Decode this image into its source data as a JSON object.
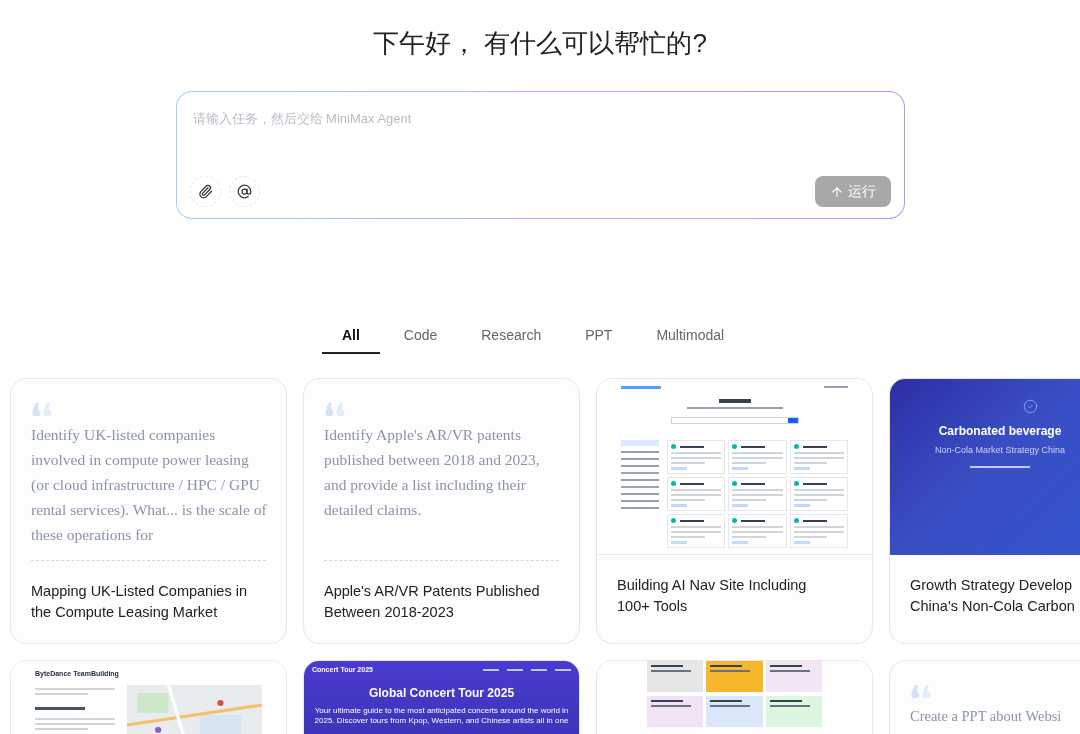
{
  "greeting": "下午好， 有什么可以帮忙的?",
  "prompt": {
    "placeholder": "请输入任务，然后交给 MiniMax Agent",
    "run_button": "运行",
    "run_disabled": true
  },
  "tabs": [
    {
      "label": "All",
      "selected": true
    },
    {
      "label": "Code",
      "selected": false
    },
    {
      "label": "Research",
      "selected": false
    },
    {
      "label": "PPT",
      "selected": false
    },
    {
      "label": "Multimodal",
      "selected": false
    }
  ],
  "cards": [
    {
      "kind": "quote",
      "quote": "Identify UK-listed companies involved in compute power leasing (or cloud infrastructure / HPC / GPU rental services). What... is the scale of these operations for",
      "title_lines": [
        "Mapping UK-Listed Companies in",
        "the Compute Leasing Market"
      ]
    },
    {
      "kind": "quote",
      "quote": "Identify Apple's AR/VR patents published between 2018 and 2023, and provide a list including their detailed claims.",
      "title_lines": [
        "Apple's AR/VR Patents Published",
        "Between 2018-2023"
      ]
    },
    {
      "kind": "thumbnail",
      "thumb": {
        "kind": "nav_site"
      },
      "title_lines": [
        "Building AI Nav Site Including",
        "100+ Tools"
      ]
    },
    {
      "kind": "thumbnail",
      "thumb": {
        "kind": "slide",
        "headline": "Carbonated beverage",
        "subtitle": "Non-Cola Market Strategy China"
      },
      "title_lines": [
        "Growth Strategy Develop",
        "China's Non-Cola Carbon"
      ]
    },
    {
      "kind": "thumbnail",
      "thumb": {
        "kind": "map_page",
        "heading": "ByteDance TeamBuilding"
      }
    },
    {
      "kind": "thumbnail",
      "thumb": {
        "kind": "concert",
        "nav_title": "Concert Tour 2025",
        "headline": "Global Concert Tour 2025",
        "description": "Your ultimate guide to the most anticipated concerts around the world in 2025. Discover tours from Kpop, Western, and Chinese artists all in one"
      }
    },
    {
      "kind": "thumbnail",
      "thumb": {
        "kind": "tiles"
      }
    },
    {
      "kind": "quote",
      "quote": "Create a PPT about Websi"
    }
  ]
}
